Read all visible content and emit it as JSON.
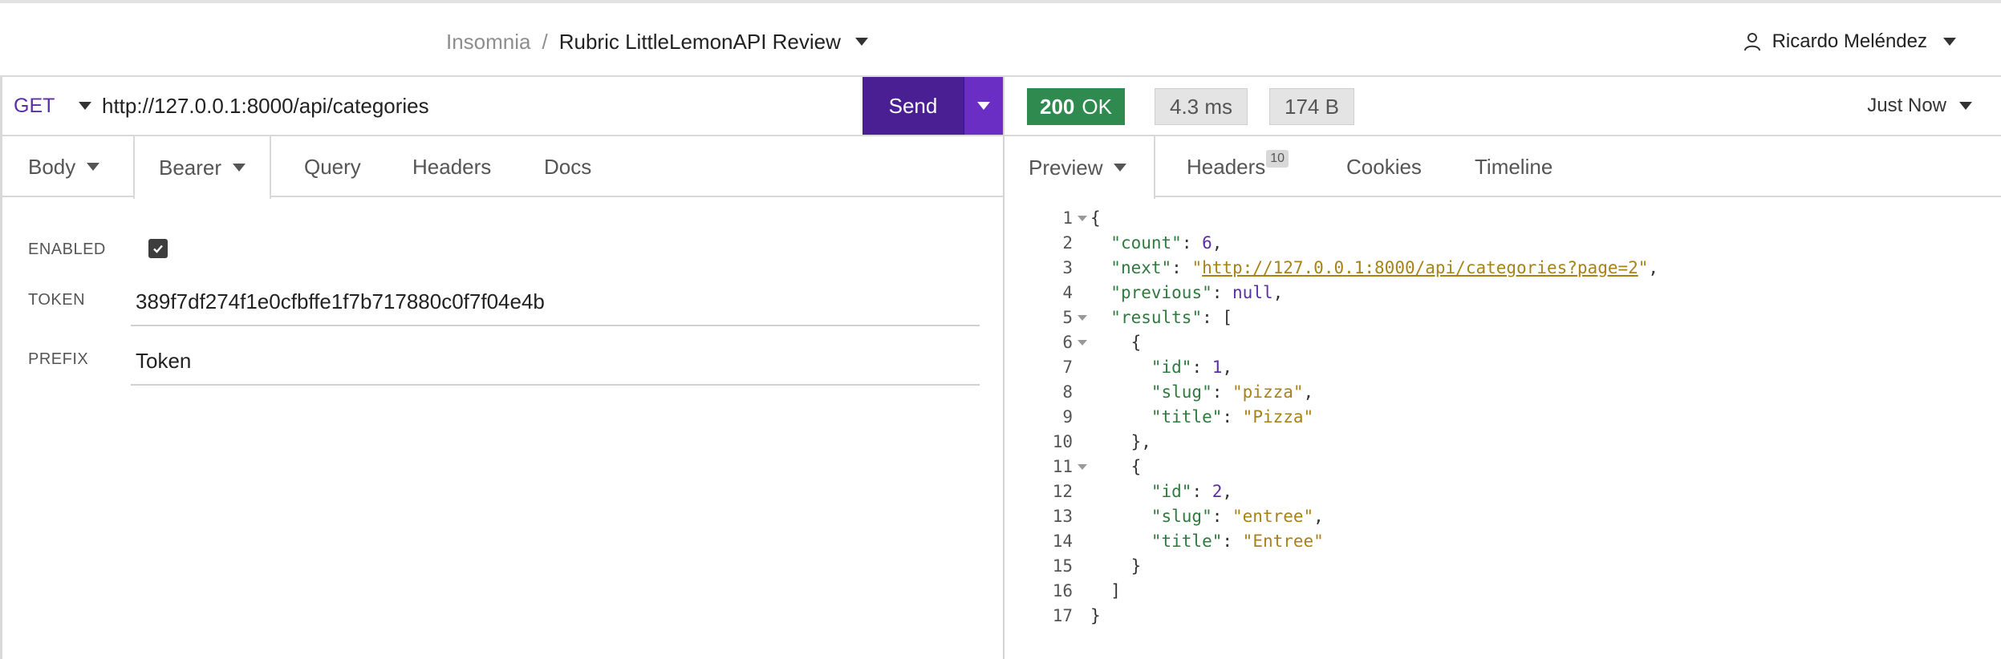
{
  "header": {
    "app_name": "Insomnia",
    "separator": "/",
    "collection": "Rubric LittleLemonAPI Review",
    "user_name": "Ricardo Meléndez"
  },
  "request": {
    "method": "GET",
    "url": "http://127.0.0.1:8000/api/categories",
    "send_label": "Send",
    "tabs": [
      {
        "label": "Body",
        "has_caret": true
      },
      {
        "label": "Bearer",
        "has_caret": true,
        "active": true
      },
      {
        "label": "Query"
      },
      {
        "label": "Headers"
      },
      {
        "label": "Docs"
      }
    ],
    "auth": {
      "enabled_label": "ENABLED",
      "enabled": true,
      "token_label": "TOKEN",
      "token_value": "389f7df274f1e0cfbffe1f7b717880c0f7f04e4b",
      "prefix_label": "PREFIX",
      "prefix_value": "Token"
    }
  },
  "response": {
    "status_code": "200",
    "status_text": "OK",
    "time": "4.3 ms",
    "size": "174 B",
    "timestamp": "Just Now",
    "tabs": [
      {
        "label": "Preview",
        "active": true,
        "has_caret": true
      },
      {
        "label": "Headers",
        "badge": "10"
      },
      {
        "label": "Cookies"
      },
      {
        "label": "Timeline"
      }
    ],
    "body_lines": [
      {
        "num": "1",
        "fold": true,
        "indent": 0,
        "tokens": [
          {
            "t": "{",
            "c": "p"
          }
        ]
      },
      {
        "num": "2",
        "fold": false,
        "indent": 1,
        "tokens": [
          {
            "t": "\"count\"",
            "c": "k"
          },
          {
            "t": ": ",
            "c": "p"
          },
          {
            "t": "6",
            "c": "n"
          },
          {
            "t": ",",
            "c": "p"
          }
        ]
      },
      {
        "num": "3",
        "fold": false,
        "indent": 1,
        "tokens": [
          {
            "t": "\"next\"",
            "c": "k"
          },
          {
            "t": ": ",
            "c": "p"
          },
          {
            "t": "\"",
            "c": "s"
          },
          {
            "t": "http://127.0.0.1:8000/api/categories?page=2",
            "c": "u"
          },
          {
            "t": "\"",
            "c": "s"
          },
          {
            "t": ",",
            "c": "p"
          }
        ]
      },
      {
        "num": "4",
        "fold": false,
        "indent": 1,
        "tokens": [
          {
            "t": "\"previous\"",
            "c": "k"
          },
          {
            "t": ": ",
            "c": "p"
          },
          {
            "t": "null",
            "c": "n"
          },
          {
            "t": ",",
            "c": "p"
          }
        ]
      },
      {
        "num": "5",
        "fold": true,
        "indent": 1,
        "tokens": [
          {
            "t": "\"results\"",
            "c": "k"
          },
          {
            "t": ": [",
            "c": "p"
          }
        ]
      },
      {
        "num": "6",
        "fold": true,
        "indent": 2,
        "tokens": [
          {
            "t": "{",
            "c": "p"
          }
        ]
      },
      {
        "num": "7",
        "fold": false,
        "indent": 3,
        "tokens": [
          {
            "t": "\"id\"",
            "c": "k"
          },
          {
            "t": ": ",
            "c": "p"
          },
          {
            "t": "1",
            "c": "n"
          },
          {
            "t": ",",
            "c": "p"
          }
        ]
      },
      {
        "num": "8",
        "fold": false,
        "indent": 3,
        "tokens": [
          {
            "t": "\"slug\"",
            "c": "k"
          },
          {
            "t": ": ",
            "c": "p"
          },
          {
            "t": "\"pizza\"",
            "c": "s"
          },
          {
            "t": ",",
            "c": "p"
          }
        ]
      },
      {
        "num": "9",
        "fold": false,
        "indent": 3,
        "tokens": [
          {
            "t": "\"title\"",
            "c": "k"
          },
          {
            "t": ": ",
            "c": "p"
          },
          {
            "t": "\"Pizza\"",
            "c": "s"
          }
        ]
      },
      {
        "num": "10",
        "fold": false,
        "indent": 2,
        "tokens": [
          {
            "t": "},",
            "c": "p"
          }
        ]
      },
      {
        "num": "11",
        "fold": true,
        "indent": 2,
        "tokens": [
          {
            "t": "{",
            "c": "p"
          }
        ]
      },
      {
        "num": "12",
        "fold": false,
        "indent": 3,
        "tokens": [
          {
            "t": "\"id\"",
            "c": "k"
          },
          {
            "t": ": ",
            "c": "p"
          },
          {
            "t": "2",
            "c": "n"
          },
          {
            "t": ",",
            "c": "p"
          }
        ]
      },
      {
        "num": "13",
        "fold": false,
        "indent": 3,
        "tokens": [
          {
            "t": "\"slug\"",
            "c": "k"
          },
          {
            "t": ": ",
            "c": "p"
          },
          {
            "t": "\"entree\"",
            "c": "s"
          },
          {
            "t": ",",
            "c": "p"
          }
        ]
      },
      {
        "num": "14",
        "fold": false,
        "indent": 3,
        "tokens": [
          {
            "t": "\"title\"",
            "c": "k"
          },
          {
            "t": ": ",
            "c": "p"
          },
          {
            "t": "\"Entree\"",
            "c": "s"
          }
        ]
      },
      {
        "num": "15",
        "fold": false,
        "indent": 2,
        "tokens": [
          {
            "t": "}",
            "c": "p"
          }
        ]
      },
      {
        "num": "16",
        "fold": false,
        "indent": 1,
        "tokens": [
          {
            "t": "]",
            "c": "p"
          }
        ]
      },
      {
        "num": "17",
        "fold": false,
        "indent": 0,
        "tokens": [
          {
            "t": "}",
            "c": "p"
          }
        ]
      }
    ]
  },
  "colors": {
    "send_button": "#4a1f94",
    "send_caret": "#6a2ec4",
    "status_ok": "#2f8a4f",
    "method": "#5b2ea6",
    "json_key": "#2f7a3e",
    "json_string": "#a88218",
    "json_number": "#5b2ea6"
  },
  "icons": {
    "user": "user-icon",
    "method_caret": "chevron-down-icon",
    "send_caret": "chevron-down-icon",
    "checkbox": "check-icon"
  }
}
